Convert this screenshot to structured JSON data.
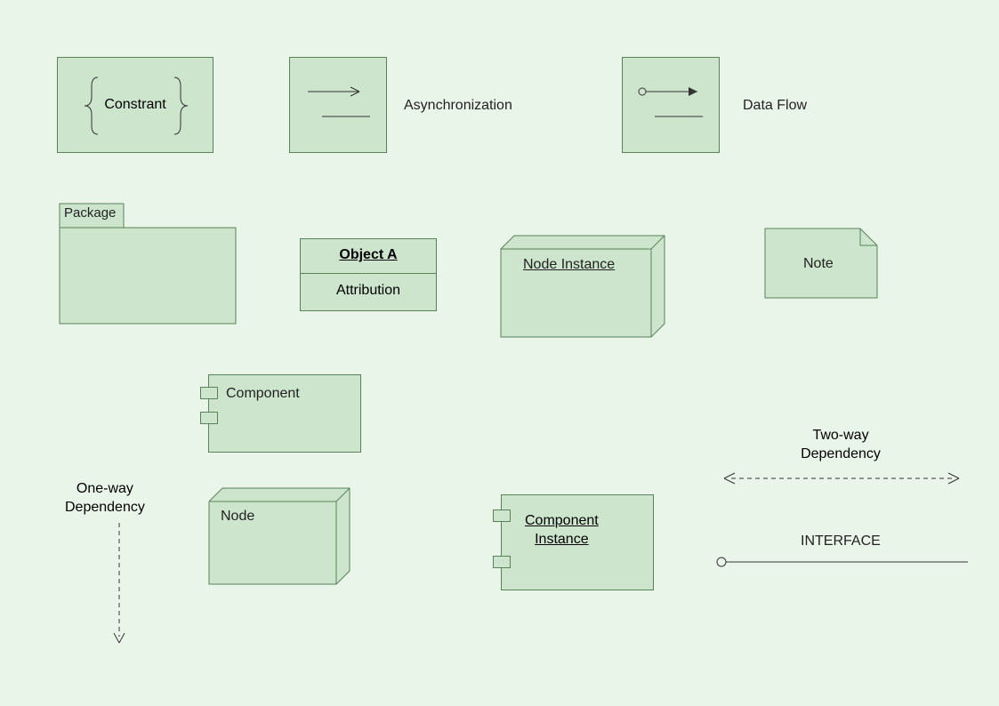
{
  "row1": {
    "constraint": "Constrant",
    "async": "Asynchronization",
    "dataflow": "Data Flow"
  },
  "row2": {
    "package": "Package",
    "object_title": "Object A",
    "object_attr": "Attribution",
    "node_instance": "Node Instance",
    "note": "Note"
  },
  "row3": {
    "component": "Component",
    "node": "Node",
    "component_instance_l1": "Component",
    "component_instance_l2": "Instance",
    "one_way_l1": "One-way",
    "one_way_l2": "Dependency",
    "two_way_l1": "Two-way",
    "two_way_l2": "Dependency",
    "interface": "INTERFACE"
  },
  "colors": {
    "fill": "#cce5cc",
    "stroke": "#5a825a"
  }
}
